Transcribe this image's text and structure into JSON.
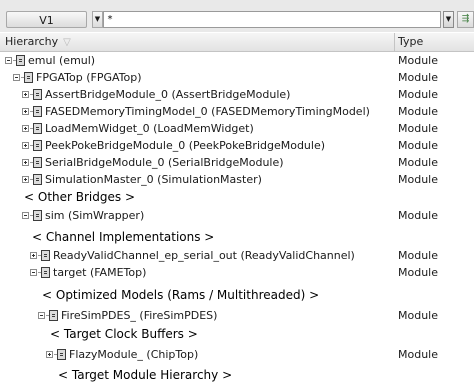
{
  "toolbar": {
    "scope_label": "V1",
    "filter_value": "*"
  },
  "columns": {
    "hierarchy": "Hierarchy",
    "type": "Type"
  },
  "rows": [
    {
      "label": "emul (emul)",
      "type": "Module"
    },
    {
      "label": "FPGATop (FPGATop)",
      "type": "Module"
    },
    {
      "label": "AssertBridgeModule_0 (AssertBridgeModule)",
      "type": "Module"
    },
    {
      "label": "FASEDMemoryTimingModel_0 (FASEDMemoryTimingModel)",
      "type": "Module"
    },
    {
      "label": "LoadMemWidget_0 (LoadMemWidget)",
      "type": "Module"
    },
    {
      "label": "PeekPokeBridgeModule_0 (PeekPokeBridgeModule)",
      "type": "Module"
    },
    {
      "label": "SerialBridgeModule_0 (SerialBridgeModule)",
      "type": "Module"
    },
    {
      "label": "SimulationMaster_0 (SimulationMaster)",
      "type": "Module"
    },
    {
      "label": "sim (SimWrapper)",
      "type": "Module"
    },
    {
      "label": "ReadyValidChannel_ep_serial_out (ReadyValidChannel)",
      "type": "Module"
    },
    {
      "label": "target (FAMETop)",
      "type": "Module"
    },
    {
      "label": "FireSimPDES_ (FireSimPDES)",
      "type": "Module"
    },
    {
      "label": "FlazyModule_ (ChipTop)",
      "type": "Module"
    }
  ],
  "annotations": {
    "other_bridges": "< Other Bridges >",
    "channel_impl": "< Channel Implementations >",
    "optimized_models": "< Optimized Models (Rams / Multithreaded) >",
    "clock_buffers": "< Target Clock Buffers >",
    "module_hierarchy": "< Target Module Hierarchy >"
  }
}
